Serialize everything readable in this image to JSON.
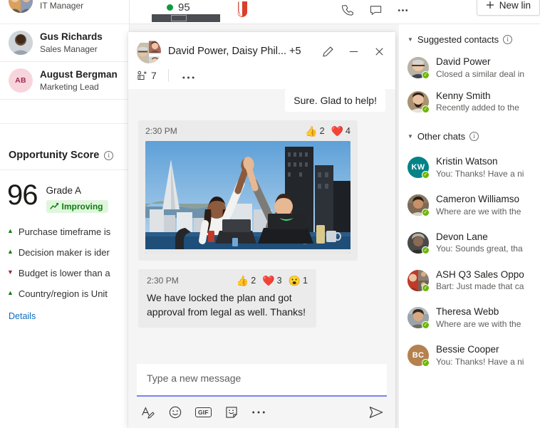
{
  "left_panel": {
    "contacts": [
      {
        "name": "",
        "role": "IT Manager",
        "initials": "",
        "avatar_type": "photo",
        "photo": "mix"
      },
      {
        "name": "Gus Richards",
        "role": "Sales Manager",
        "initials": "",
        "avatar_type": "photo",
        "photo": "man1"
      },
      {
        "name": "August Bergman",
        "role": "Marketing Lead",
        "initials": "AB",
        "avatar_type": "initials",
        "bg": "#f8d5dd",
        "fg": "#9c2b52"
      }
    ],
    "opportunity": {
      "title": "Opportunity Score",
      "info_icon": "info-icon",
      "score": "96",
      "grade": "Grade A",
      "trend_label": "Improving",
      "trend_icon": "trend-up-icon",
      "trend_color": "#107c10",
      "trend_bg": "#dff6dd",
      "factors": [
        {
          "dir": "up",
          "text": "Purchase timeframe is"
        },
        {
          "dir": "up",
          "text": "Decision maker is ider"
        },
        {
          "dir": "down",
          "text": "Budget is lower than a"
        },
        {
          "dir": "up",
          "text": "Country/region is Unit"
        }
      ],
      "details_label": "Details",
      "link_color": "#0f6cbd"
    }
  },
  "top_strip": {
    "score_value": "95",
    "status_dot_color": "#0b9d3c",
    "icons": [
      "phone-icon",
      "chat-icon",
      "more-icon"
    ],
    "new_link_button": {
      "label": "New lin",
      "icon": "plus-icon"
    }
  },
  "chat_window": {
    "title": "David Power, Daisy Phil... +5",
    "avatar_name": "group-avatar",
    "header_buttons": [
      {
        "name": "edit-pencil-icon"
      },
      {
        "name": "minimize-icon"
      },
      {
        "name": "close-icon"
      }
    ],
    "subbar": {
      "people_icon": "add-people-icon",
      "people_count": "7",
      "more_label": "•••"
    },
    "messages": [
      {
        "kind": "white-text",
        "text": "Sure. Glad to help!",
        "align": "right"
      },
      {
        "kind": "image",
        "time": "2:30 PM",
        "reactions": [
          {
            "emoji": "👍",
            "name": "thumbs-up-reaction",
            "count": "2"
          },
          {
            "emoji": "❤️",
            "name": "heart-reaction",
            "count": "4"
          }
        ],
        "image_alt": "two coworkers high-fiving at desks with San Francisco skyline backdrop"
      },
      {
        "kind": "text",
        "time": "2:30 PM",
        "reactions": [
          {
            "emoji": "👍",
            "name": "thumbs-up-reaction",
            "count": "2"
          },
          {
            "emoji": "❤️",
            "name": "heart-reaction",
            "count": "3"
          },
          {
            "emoji": "😮",
            "name": "surprised-reaction",
            "count": "1"
          }
        ],
        "text": "We have locked the plan and got approval from legal as well. Thanks!"
      }
    ],
    "compose": {
      "placeholder": "Type a new message",
      "value": "",
      "underline_color": "#7b83eb",
      "tools": [
        {
          "name": "format-text-icon",
          "label": "A"
        },
        {
          "name": "emoji-icon",
          "label": "☺"
        },
        {
          "name": "gif-icon",
          "label": "GIF"
        },
        {
          "name": "sticker-icon",
          "label": "sticker"
        },
        {
          "name": "more-options-icon",
          "label": "•••"
        }
      ],
      "send_icon": "send-icon"
    }
  },
  "right_panel": {
    "groups": [
      {
        "title": "Suggested contacts",
        "info_icon": "info-icon",
        "items": [
          {
            "name": "David Power",
            "preview": "Closed a similar deal in",
            "initials": "",
            "avatar_type": "photo",
            "photo": "man_bald"
          },
          {
            "name": "Kenny Smith",
            "preview": "Recently added to the",
            "initials": "",
            "avatar_type": "photo",
            "photo": "man_beard"
          }
        ]
      },
      {
        "title": "Other chats",
        "info_icon": "info-icon",
        "items": [
          {
            "name": "Kristin Watson",
            "preview": "You: Thanks! Have a ni",
            "initials": "KW",
            "avatar_type": "initials",
            "bg": "#038387",
            "fg": "#ffffff"
          },
          {
            "name": "Cameron Williamso",
            "preview": "Where are we with the",
            "initials": "",
            "avatar_type": "photo",
            "photo": "woman1"
          },
          {
            "name": "Devon Lane",
            "preview": "You: Sounds great, tha",
            "initials": "",
            "avatar_type": "photo",
            "photo": "dark1"
          },
          {
            "name": "ASH Q3 Sales Oppo",
            "preview": "Bart: Just made that ca",
            "initials": "",
            "avatar_type": "photo",
            "photo": "group1"
          },
          {
            "name": "Theresa Webb",
            "preview": "Where are we with the",
            "initials": "",
            "avatar_type": "photo",
            "photo": "woman2"
          },
          {
            "name": "Bessie Cooper",
            "preview": "You: Thanks! Have a ni",
            "initials": "BC",
            "avatar_type": "initials",
            "bg": "#b5814f",
            "fg": "#ffffff"
          }
        ]
      }
    ]
  }
}
